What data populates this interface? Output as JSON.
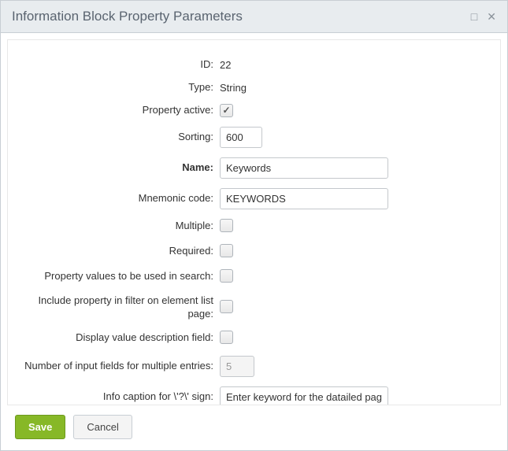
{
  "window": {
    "title": "Information Block Property Parameters"
  },
  "form": {
    "id_label": "ID:",
    "id_value": "22",
    "type_label": "Type:",
    "type_value": "String",
    "active_label": "Property active:",
    "active_checked": true,
    "sorting_label": "Sorting:",
    "sorting_value": "600",
    "name_label": "Name:",
    "name_value": "Keywords",
    "mnemonic_label": "Mnemonic code:",
    "mnemonic_value": "KEYWORDS",
    "multiple_label": "Multiple:",
    "multiple_checked": false,
    "required_label": "Required:",
    "required_checked": false,
    "search_label": "Property values to be used in search:",
    "search_checked": false,
    "filter_label": "Include property in filter on element list page:",
    "filter_checked": false,
    "display_desc_label": "Display value description field:",
    "display_desc_checked": false,
    "num_fields_label": "Number of input fields for multiple entries:",
    "num_fields_value": "5",
    "info_caption_label": "Info caption for \\'?\\' sign:",
    "info_caption_value": "Enter keyword for the datailed pag"
  },
  "footer": {
    "save": "Save",
    "cancel": "Cancel"
  }
}
